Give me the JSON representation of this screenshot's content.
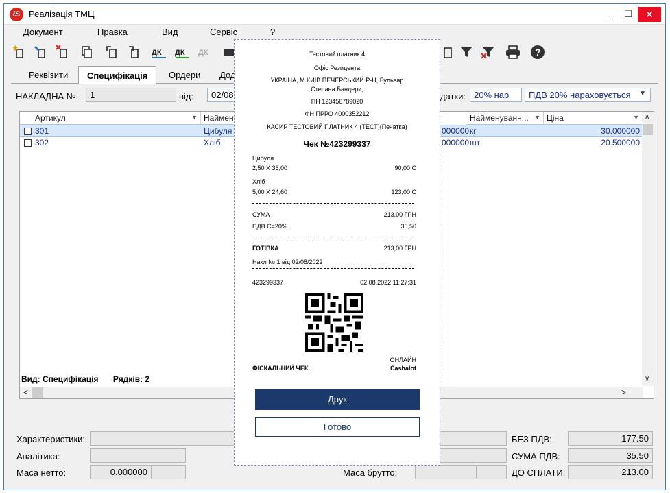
{
  "window": {
    "title": "Реалізація ТМЦ",
    "controls": {
      "minimize": "_",
      "maximize": "☐",
      "close": "✕"
    }
  },
  "menu": [
    "Документ",
    "Правка",
    "Вид",
    "Сервіс",
    "?"
  ],
  "tabs": [
    "Реквізити",
    "Специфікація",
    "Ордери",
    "Дод"
  ],
  "header": {
    "invoice_label": "НАКЛАДНА №:",
    "invoice_value": "1",
    "date_label": "від:",
    "date_value": "02/08",
    "tax_label": "датки:",
    "vat_rate": "20% нар",
    "vat_mode": "ПДВ 20% нараховується"
  },
  "grid": {
    "columns": [
      "Артикул",
      "Наймену",
      "Найменуванн...",
      "Ціна"
    ],
    "rows": [
      {
        "article": "301",
        "name": "Цибуля",
        "qty": "000000",
        "unit": "кг",
        "price": "30.000000"
      },
      {
        "article": "302",
        "name": "Хліб",
        "qty": "000000",
        "unit": "шт",
        "price": "20.500000"
      }
    ],
    "status_view": "Вид: Специфікація",
    "status_rows": "Рядків: 2"
  },
  "footer": {
    "characteristics_label": "Характеристики:",
    "analytics_label": "Аналітика:",
    "net_mass_label": "Маса нетто:",
    "net_mass_value": "0.000000",
    "gross_mass_label": "Маса брутто:",
    "no_vat_label": "БЕЗ ПДВ:",
    "no_vat_value": "177.50",
    "vat_sum_label": "СУМА ПДВ:",
    "vat_sum_value": "35.50",
    "to_pay_label": "ДО СПЛАТИ:",
    "to_pay_value": "213.00"
  },
  "receipt": {
    "header_lines": [
      "Тестовий платник 4",
      "Офіс Резидента",
      "УКРАЇНА, М.КИЇВ ПЕЧЕРСЬКИЙ Р-Н, Бульвар",
      "Степана Бандери,",
      "ПН 123456789020",
      "ФН ПРРО 4000352212",
      "КАСИР ТЕСТОВИЙ ПЛАТНИК 4 (ТЕСТ)(Печатка)"
    ],
    "check_title": "Чек №423299337",
    "items": [
      {
        "name": "Цибуля",
        "calc": "2,50 X 36,00",
        "sum": "90,00 С"
      },
      {
        "name": "Хліб",
        "calc": "5,00 X 24,60",
        "sum": "123,00 С"
      }
    ],
    "sum_label": "СУМА",
    "sum_value": "213,00 ГРН",
    "vat_label": "ПДВ С=20%",
    "vat_value": "35,50",
    "cash_label": "ГОТІВКА",
    "cash_value": "213,00 ГРН",
    "invoice_ref": "Накл № 1 від 02/08/2022",
    "fiscal_no": "423299337",
    "datetime": "02.08.2022 11:27:31",
    "fiscal_label": "ФІСКАЛЬНИЙ ЧЕК",
    "online_label": "ОНЛАЙН",
    "provider": "Cashalot",
    "print_button": "Друк",
    "done_button": "Готово"
  },
  "colors": {
    "accent": "#1b3a6b",
    "selection": "#d7e8fb",
    "close": "#e81123"
  }
}
